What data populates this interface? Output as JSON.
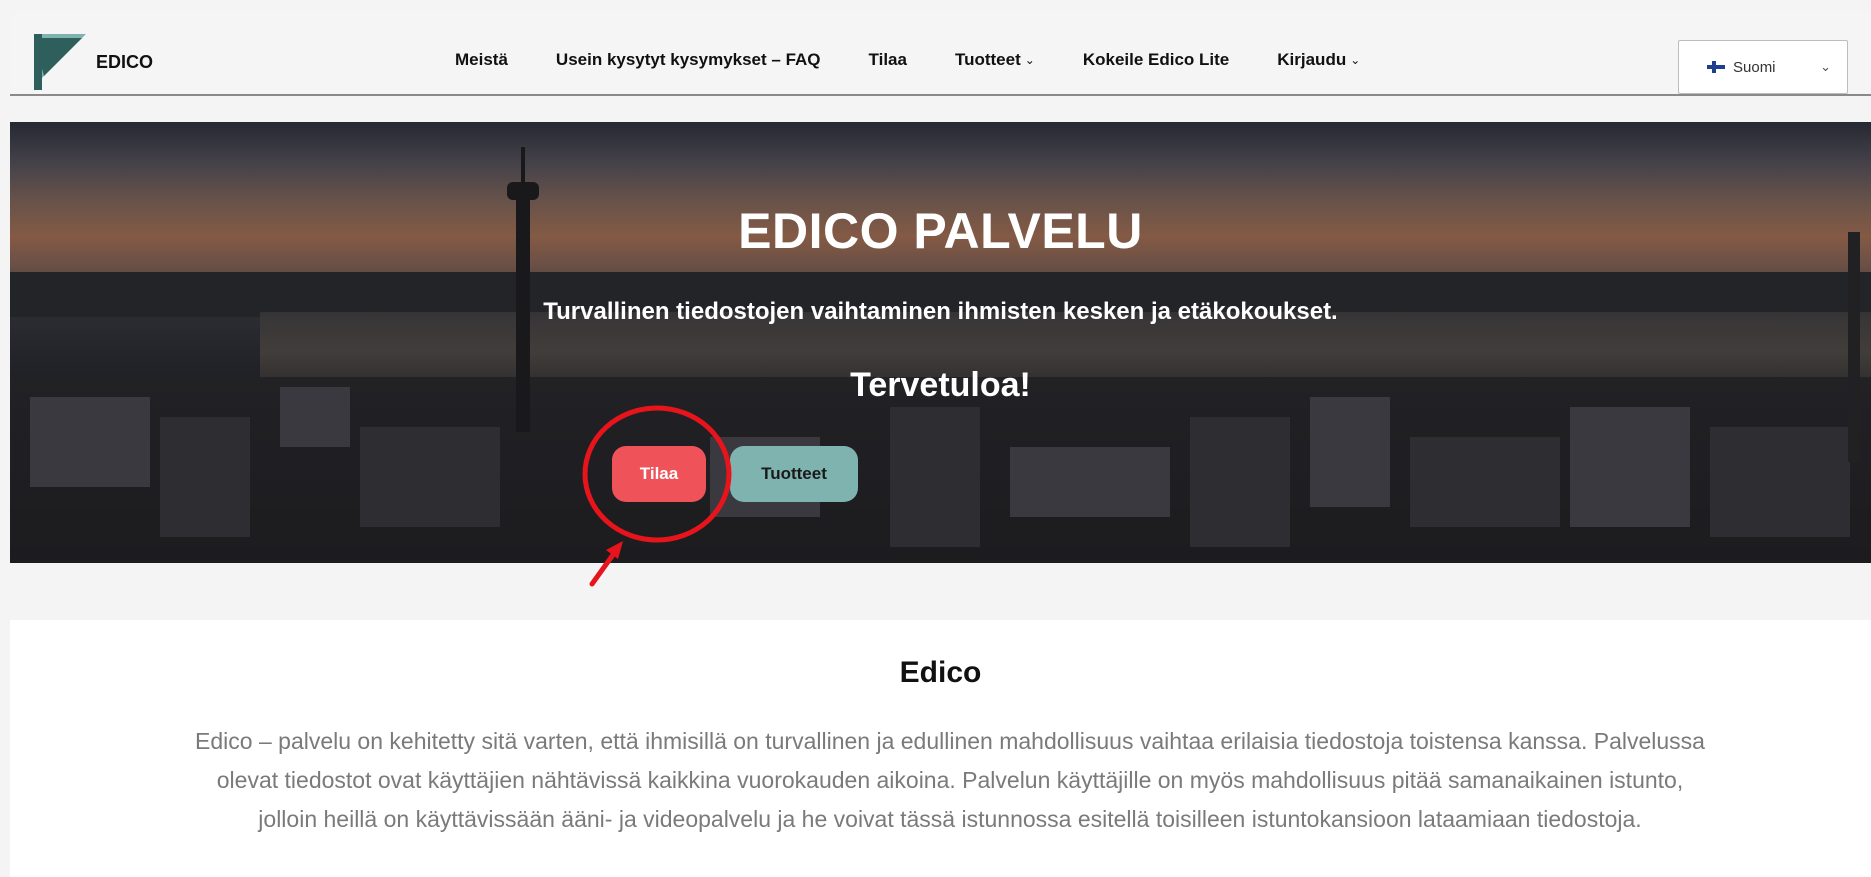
{
  "header": {
    "logo_text": "EDICO",
    "nav": [
      {
        "label": "Meistä",
        "has_dropdown": false
      },
      {
        "label": "Usein kysytyt kysymykset – FAQ",
        "has_dropdown": false
      },
      {
        "label": "Tilaa",
        "has_dropdown": false
      },
      {
        "label": "Tuotteet",
        "has_dropdown": true
      },
      {
        "label": "Kokeile Edico Lite",
        "has_dropdown": false
      },
      {
        "label": "Kirjaudu",
        "has_dropdown": true
      }
    ],
    "language": {
      "selected": "Suomi",
      "flag": "finland-flag-icon"
    },
    "colors": {
      "logo_dark": "#2f5f5c",
      "logo_light": "#7fb3b0"
    }
  },
  "hero": {
    "title": "EDICO PALVELU",
    "subtitle": "Turvallinen tiedostojen vaihtaminen ihmisten kesken ja etäkokoukset.",
    "welcome": "Tervetuloa!",
    "buttons": [
      {
        "label": "Tilaa",
        "color": "#f0525a"
      },
      {
        "label": "Tuotteet",
        "color": "#7fb3b0"
      }
    ]
  },
  "annotation": {
    "color": "#e8141b",
    "target": "Tilaa"
  },
  "content": {
    "title": "Edico",
    "text": "Edico – palvelu on kehitetty sitä varten, että ihmisillä on turvallinen ja edullinen mahdollisuus vaihtaa erilaisia tiedostoja toistensa kanssa. Palvelussa olevat tiedostot ovat käyttäjien nähtävissä kaikkina vuorokauden aikoina. Palvelun käyttäjille on myös mahdollisuus pitää samanaikainen istunto, jolloin heillä on käyttävissään ääni- ja videopalvelu ja he voivat tässä istunnossa esitellä toisilleen istuntokansioon lataamiaan tiedostoja."
  }
}
